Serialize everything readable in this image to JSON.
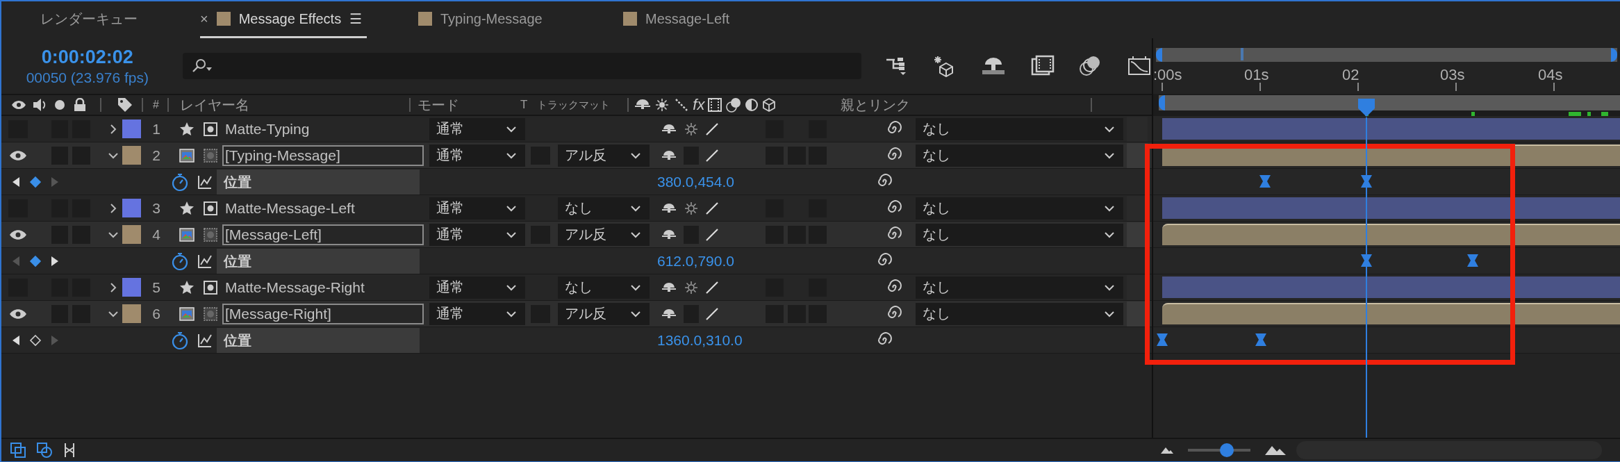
{
  "tabs": [
    {
      "label": "レンダーキュー",
      "kind": "panel",
      "selected": false
    },
    {
      "label": "Message Effects",
      "kind": "comp",
      "selected": true,
      "close": "×",
      "menu": "☰",
      "color": "#a08b6c"
    },
    {
      "label": "Typing-Message",
      "kind": "comp",
      "selected": false,
      "color": "#a08b6c"
    },
    {
      "label": "Message-Left",
      "kind": "comp",
      "selected": false,
      "color": "#a08b6c"
    }
  ],
  "timecode": "0:00:02:02",
  "frame_info": "00050 (23.976 fps)",
  "columns": {
    "number": "#",
    "layer_name": "レイヤー名",
    "mode": "モード",
    "t": "T",
    "track_matte": "トラックマット",
    "fx": "fx",
    "parent": "親とリンク"
  },
  "ruler_labels": [
    ":00s",
    "01s",
    "02",
    "03s",
    "04s"
  ],
  "playhead": {
    "level": 0.446
  },
  "rows": [
    {
      "kind": "shape",
      "number": "1",
      "name": "Matte-Typing",
      "visible": false,
      "expanded": false,
      "color": "#6573e0",
      "mode": "通常",
      "parent": "なし"
    },
    {
      "kind": "footage",
      "number": "2",
      "name": "[Typing-Message]",
      "visible": true,
      "expanded": true,
      "color": "#a08b6c",
      "mode": "通常",
      "track_matte": "アル反",
      "parent": "なし"
    },
    {
      "kind": "property",
      "name": "位置",
      "value": "380.0,454.0",
      "at_keyframe": true,
      "prev": true,
      "next": false,
      "keyframes": [
        {
          "level": 0.225
        },
        {
          "level": 0.446
        }
      ]
    },
    {
      "kind": "shape",
      "number": "3",
      "name": "Matte-Message-Left",
      "visible": false,
      "expanded": false,
      "color": "#6573e0",
      "mode": "通常",
      "track_matte": "なし",
      "parent": "なし"
    },
    {
      "kind": "footage",
      "number": "4",
      "name": "[Message-Left]",
      "visible": true,
      "expanded": true,
      "color": "#a08b6c",
      "mode": "通常",
      "track_matte": "アル反",
      "parent": "なし"
    },
    {
      "kind": "property",
      "name": "位置",
      "value": "612.0,790.0",
      "at_keyframe": true,
      "prev": false,
      "next": true,
      "keyframes": [
        {
          "level": 0.446
        },
        {
          "level": 0.678
        }
      ]
    },
    {
      "kind": "shape",
      "number": "5",
      "name": "Matte-Message-Right",
      "visible": false,
      "expanded": false,
      "color": "#6573e0",
      "mode": "通常",
      "track_matte": "なし",
      "parent": "なし"
    },
    {
      "kind": "footage",
      "number": "6",
      "name": "[Message-Right]",
      "visible": true,
      "expanded": true,
      "color": "#a08b6c",
      "mode": "通常",
      "track_matte": "アル反",
      "parent": "なし"
    },
    {
      "kind": "property",
      "name": "位置",
      "value": "1360.0,310.0",
      "at_keyframe": false,
      "prev": true,
      "next": false,
      "keyframes": [
        {
          "level": 0.0
        },
        {
          "level": 0.215
        }
      ]
    }
  ],
  "zoom_slider": {
    "level": 0.62
  },
  "highlight": {
    "kind": "rectangle"
  }
}
